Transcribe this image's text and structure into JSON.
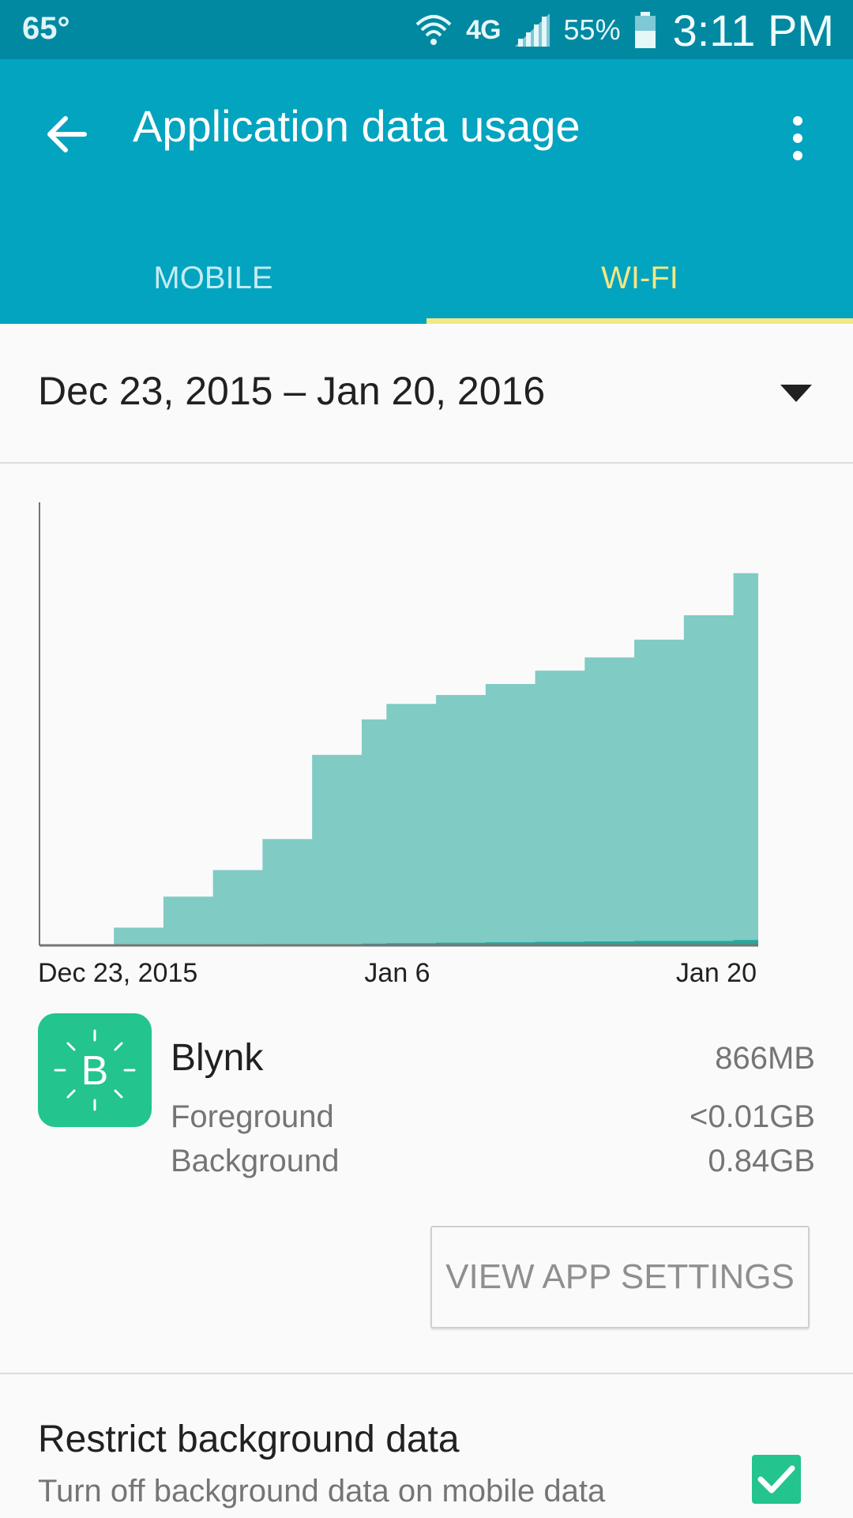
{
  "status_bar": {
    "temperature": "65°",
    "network": "4G",
    "battery_percent": "55%",
    "time": "3:11 PM",
    "icons": [
      "wifi-icon",
      "network-4g-lte-icon",
      "signal-icon",
      "battery-icon"
    ]
  },
  "app_bar": {
    "title": "Application data usage",
    "back_icon": "arrow-back-icon",
    "menu_icon": "more-vert-icon"
  },
  "tabs": [
    {
      "label": "MOBILE",
      "selected": false
    },
    {
      "label": "WI-FI",
      "selected": true
    }
  ],
  "date_range": {
    "label": "Dec 23, 2015 – Jan 20, 2016",
    "icon": "dropdown-arrow-icon"
  },
  "chart_data": {
    "type": "area",
    "title": "",
    "xlabel": "",
    "ylabel": "",
    "x_tick_labels": [
      "Dec 23, 2015",
      "Jan 6",
      "Jan 20"
    ],
    "x": [
      1,
      3,
      5,
      7,
      9,
      11,
      13,
      14,
      16,
      18,
      20,
      22,
      24,
      26,
      28,
      29
    ],
    "series": [
      {
        "name": "",
        "values": [
          1,
          40,
          110,
          170,
          240,
          430,
          510,
          545,
          565,
          590,
          620,
          650,
          690,
          745,
          840,
          840
        ]
      },
      {
        "name": "",
        "values": [
          0,
          0,
          1,
          2,
          3,
          3,
          4,
          5,
          6,
          7,
          8,
          9,
          10,
          10,
          12,
          12
        ]
      }
    ],
    "ylim": [
      0,
      1000
    ],
    "grid": false,
    "colors": [
      "#80cbc4",
      "#26a69a"
    ]
  },
  "app": {
    "name": "Blynk",
    "icon": "blynk-logo-icon",
    "icon_letter": "B",
    "icon_color": "#23c48e",
    "total": "866MB",
    "foreground_label": "Foreground",
    "foreground_value": "<0.01GB",
    "background_label": "Background",
    "background_value": "0.84GB"
  },
  "view_settings_label": "VIEW APP SETTINGS",
  "restrict": {
    "title": "Restrict background data",
    "description": "Turn off background data on mobile data",
    "checked": true
  },
  "colors": {
    "status_bar": "#0189a1",
    "app_bar": "#02a4c0",
    "tab_active": "#f4e784",
    "tab_inactive": "#c5ebf3",
    "accent_green": "#23c48e"
  }
}
